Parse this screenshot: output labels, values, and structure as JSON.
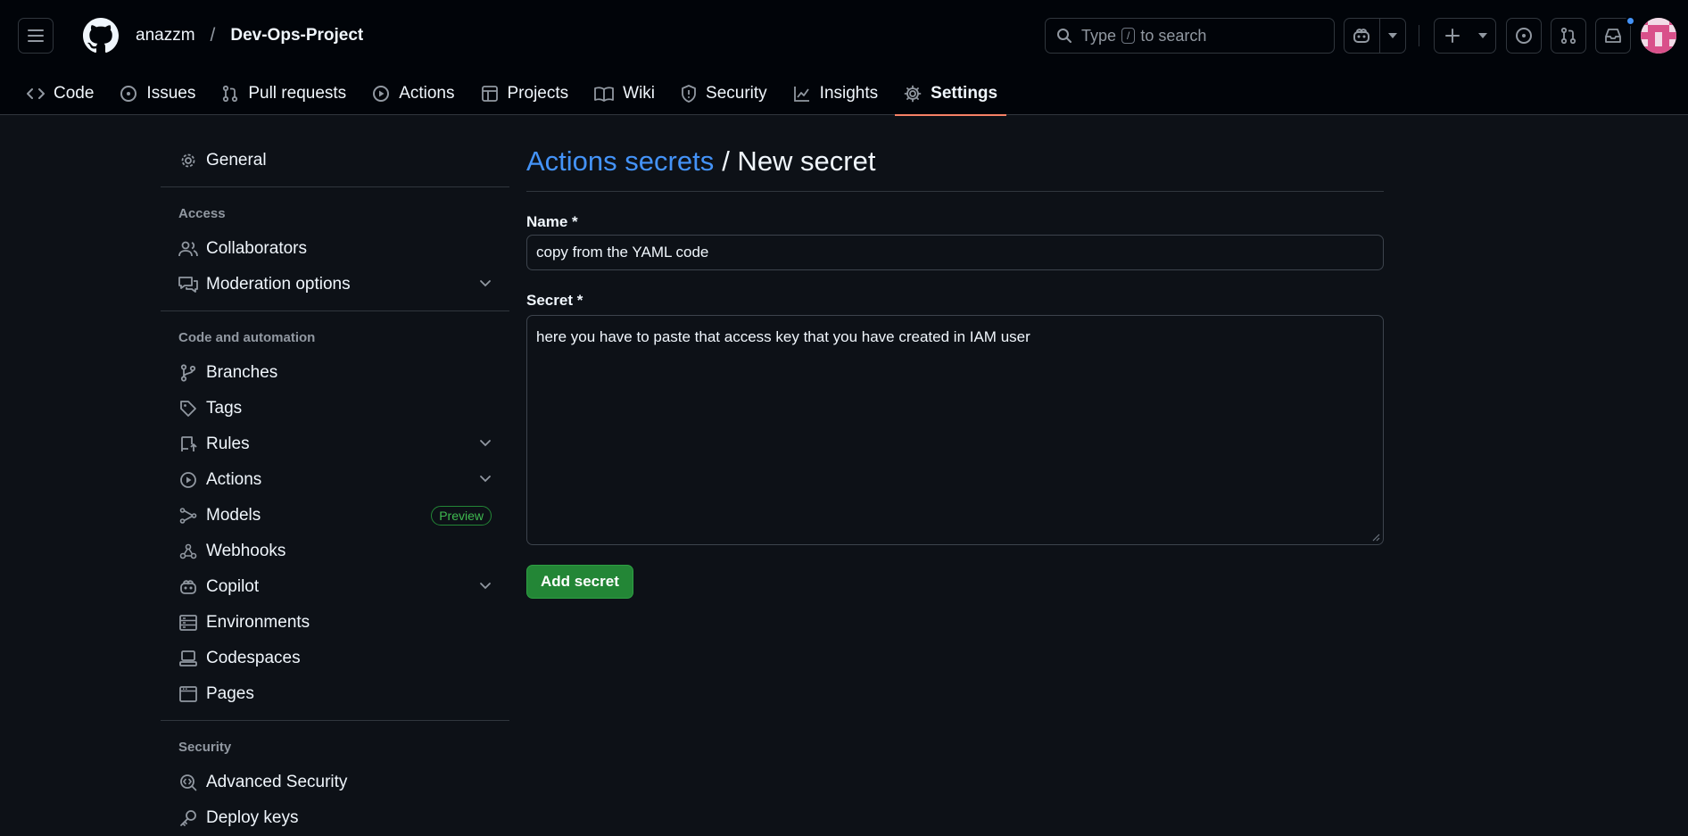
{
  "header": {
    "owner": "anazzm",
    "separator": "/",
    "repo": "Dev-Ops-Project",
    "search": {
      "prefix": "Type",
      "key": "/",
      "suffix": "to search"
    }
  },
  "tabs": [
    {
      "label": "Code",
      "icon": "code-icon"
    },
    {
      "label": "Issues",
      "icon": "issue-icon"
    },
    {
      "label": "Pull requests",
      "icon": "pull-request-icon"
    },
    {
      "label": "Actions",
      "icon": "play-icon"
    },
    {
      "label": "Projects",
      "icon": "table-icon"
    },
    {
      "label": "Wiki",
      "icon": "book-icon"
    },
    {
      "label": "Security",
      "icon": "shield-icon"
    },
    {
      "label": "Insights",
      "icon": "graph-icon"
    },
    {
      "label": "Settings",
      "icon": "gear-icon",
      "active": true
    }
  ],
  "sidebar": {
    "general": "General",
    "access_heading": "Access",
    "collaborators": "Collaborators",
    "moderation": "Moderation options",
    "code_heading": "Code and automation",
    "branches": "Branches",
    "tags": "Tags",
    "rules": "Rules",
    "actions": "Actions",
    "models": "Models",
    "models_badge": "Preview",
    "webhooks": "Webhooks",
    "copilot": "Copilot",
    "environments": "Environments",
    "codespaces": "Codespaces",
    "pages": "Pages",
    "security_heading": "Security",
    "advanced_security": "Advanced Security",
    "deploy_keys": "Deploy keys"
  },
  "main": {
    "title_link": "Actions secrets",
    "title_rest": "/ New secret",
    "name_label": "Name *",
    "name_value": "copy from the YAML code",
    "secret_label": "Secret *",
    "secret_value": "here you have to paste that access key that you have created in IAM user",
    "submit_label": "Add secret"
  },
  "colors": {
    "accent_tab": "#f78166",
    "link": "#4493f8",
    "primary_button": "#238636",
    "notification_dot": "#4493f8"
  }
}
